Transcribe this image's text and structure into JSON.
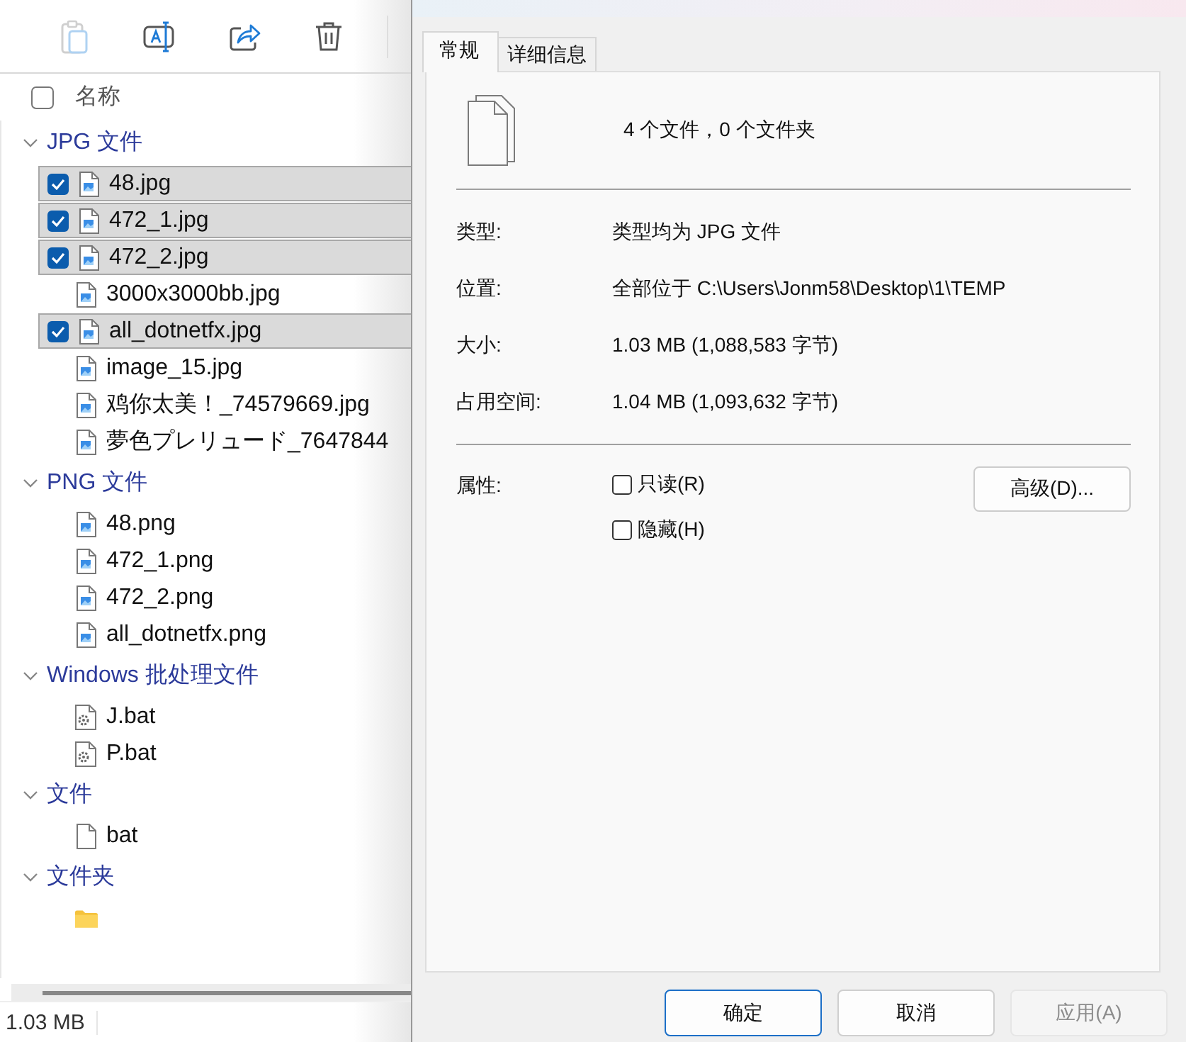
{
  "toolbar": [
    {
      "kind": "paste",
      "disabled": true
    },
    {
      "kind": "rename",
      "disabled": false
    },
    {
      "kind": "share",
      "disabled": false
    },
    {
      "kind": "delete",
      "disabled": false
    }
  ],
  "header": {
    "label": "名称",
    "checked": false
  },
  "groups": [
    {
      "label": "JPG 文件",
      "expanded": true,
      "items": [
        {
          "name": "48.jpg",
          "kind": "image",
          "selected": true
        },
        {
          "name": "472_1.jpg",
          "kind": "image",
          "selected": true
        },
        {
          "name": "472_2.jpg",
          "kind": "image",
          "selected": true
        },
        {
          "name": "3000x3000bb.jpg",
          "kind": "image",
          "selected": false
        },
        {
          "name": "all_dotnetfx.jpg",
          "kind": "image",
          "selected": true
        },
        {
          "name": "image_15.jpg",
          "kind": "image",
          "selected": false
        },
        {
          "name": "鸡你太美！_74579669.jpg",
          "kind": "image",
          "selected": false
        },
        {
          "name": "夢色プレリュード_7647844",
          "kind": "image",
          "selected": false
        }
      ]
    },
    {
      "label": "PNG 文件",
      "expanded": true,
      "items": [
        {
          "name": "48.png",
          "kind": "image",
          "selected": false
        },
        {
          "name": "472_1.png",
          "kind": "image",
          "selected": false
        },
        {
          "name": "472_2.png",
          "kind": "image",
          "selected": false
        },
        {
          "name": "all_dotnetfx.png",
          "kind": "image",
          "selected": false
        }
      ]
    },
    {
      "label": "Windows 批处理文件",
      "expanded": true,
      "items": [
        {
          "name": "J.bat",
          "kind": "batch",
          "selected": false
        },
        {
          "name": "P.bat",
          "kind": "batch",
          "selected": false
        }
      ]
    },
    {
      "label": "文件",
      "expanded": true,
      "items": [
        {
          "name": "bat",
          "kind": "file",
          "selected": false
        }
      ]
    },
    {
      "label": "文件夹",
      "expanded": true,
      "items": [
        {
          "kind": "folder",
          "selected": false
        }
      ]
    }
  ],
  "status_bar": {
    "text": "1.03 MB"
  },
  "dialog": {
    "tabs": [
      {
        "label": "常规",
        "selected": true
      },
      {
        "label": "详细信息",
        "selected": false
      }
    ],
    "summary": "4 个文件，0 个文件夹",
    "properties": [
      {
        "label": "类型:",
        "value": "类型均为 JPG 文件"
      },
      {
        "label": "位置:",
        "value": "全部位于 C:\\Users\\Jonm58\\Desktop\\1\\TEMP"
      },
      {
        "label": "大小:",
        "value": "1.03 MB (1,088,583 字节)"
      },
      {
        "label": "占用空间:",
        "value": "1.04 MB (1,093,632 字节)"
      }
    ],
    "attributes": {
      "label": "属性:",
      "options": [
        {
          "label": "只读(R)",
          "checked": false
        },
        {
          "label": "隐藏(H)",
          "checked": false
        }
      ],
      "advanced_button": "高级(D)..."
    },
    "buttons": [
      {
        "label": "确定",
        "kind": "default",
        "disabled": false
      },
      {
        "label": "取消",
        "kind": "normal",
        "disabled": false
      },
      {
        "label": "应用(A)",
        "kind": "normal",
        "disabled": true
      }
    ]
  }
}
